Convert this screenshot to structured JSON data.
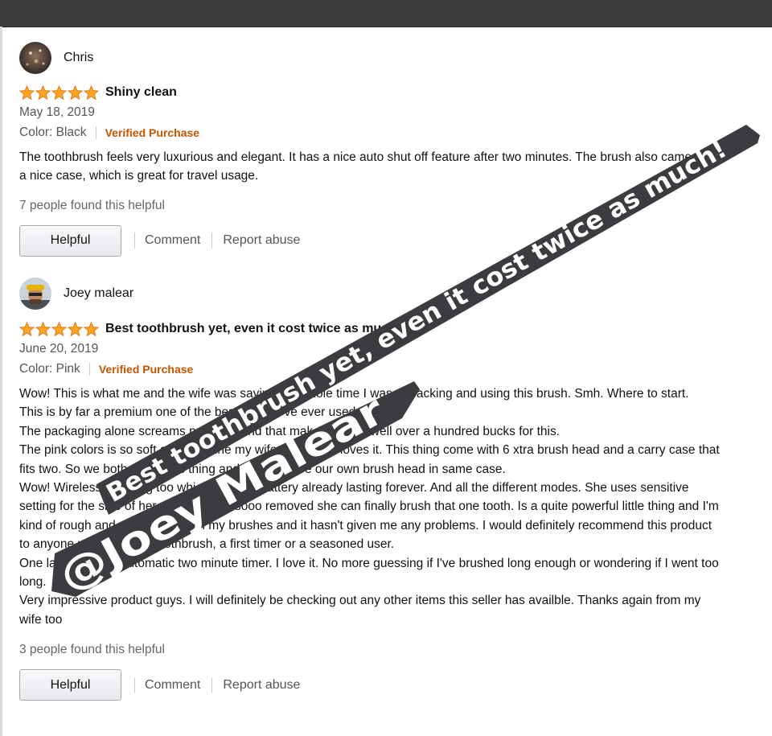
{
  "reviews": [
    {
      "reviewer": "Chris",
      "avatar_icon": "avatar-photo-icon",
      "rating": 5,
      "title": "Shiny clean",
      "date": "May 18, 2019",
      "color": "Color: Black",
      "verified": "Verified Purchase",
      "body": [
        "The toothbrush feels very luxurious and elegant. It has a nice auto shut off feature after two minutes. The brush also came with a nice case, which is great for travel usage."
      ],
      "helpful_count": "7 people found this helpful",
      "helpful_label": "Helpful",
      "comment_label": "Comment",
      "report_label": "Report abuse"
    },
    {
      "reviewer": "Joey malear",
      "avatar_icon": "avatar-photo-icon",
      "rating": 5,
      "title": "Best toothbrush yet, even it cost twice as much!",
      "date": "June 20, 2019",
      "color": "Color: Pink",
      "verified": "Verified Purchase",
      "body": [
        "Wow! This is what me and the wife was saying the whole time I was unpacking and using this brush. Smh. Where to start.",
        "This is by far a premium one of the best things I've ever used.",
        "The packaging alone screams premium and that makes I spent well over a hundred bucks for this.",
        "The pink colors is so soft and feminine my wife absolutely loves it. This thing come with 6 xtra brush head and a carry case that fits two. So we both share this thing and always have our own brush head in same case.",
        "Wow! Wireless charging too which I love it. Battery already lasting forever. And all the different modes. She uses sensitive setting for the side of her mouth and is sooo removed she can finally brush that one tooth. Is a quite powerful little thing and I'm kind of rough and aggressive with my brushes and it hasn't given me any problems. I would definitely recommend this product to anyone using electric toothbrush, a first timer or a seasoned user.",
        "One last thing the automatic two minute timer. I love it. No more guessing if I've brushed long enough or wondering if I went too long.",
        "Very impressive product guys. I will definitely be checking out any other items this seller has availble. Thanks again from my wife too"
      ],
      "helpful_count": "3 people found this helpful",
      "helpful_label": "Helpful",
      "comment_label": "Comment",
      "report_label": "Report abuse"
    }
  ],
  "watermark": {
    "line1": "Best toothbrush yet, even it cost twice as much!",
    "line2": "@Joey Malear",
    "band_color": "#3b3c3f",
    "text_color": "#ffffff"
  },
  "colors": {
    "star": "#ffa41c",
    "star_outline": "#de7921",
    "verified": "#c45500",
    "topbar": "#3a3b3d"
  }
}
